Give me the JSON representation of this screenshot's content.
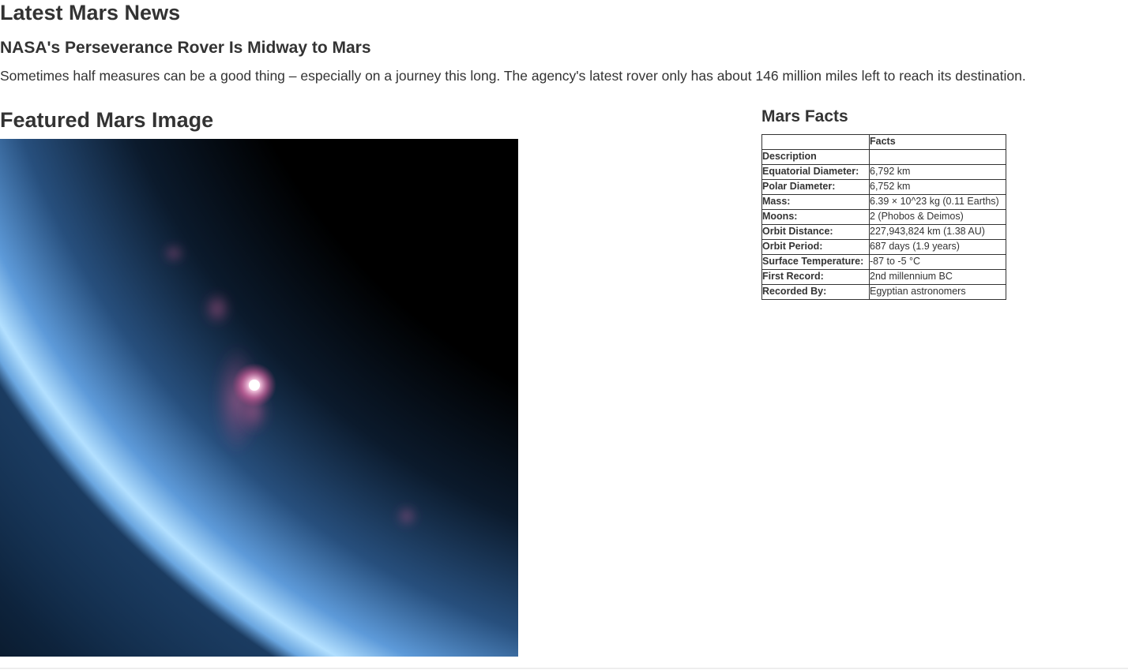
{
  "news": {
    "section_heading": "Latest Mars News",
    "title": "NASA's Perseverance Rover Is Midway to Mars",
    "teaser": "Sometimes half measures can be a good thing – especially on a journey this long. The agency's latest rover only has about 146 million miles left to reach its destination."
  },
  "featured": {
    "section_heading": "Featured Mars Image",
    "image_subject": "Mars limb with blue atmospheric haze and a bright pink star-like glow"
  },
  "facts": {
    "section_heading": "Mars Facts",
    "header_label": "",
    "header_value": "Facts",
    "index_label": "Description",
    "rows": [
      {
        "label": "Equatorial Diameter:",
        "value": "6,792 km"
      },
      {
        "label": "Polar Diameter:",
        "value": "6,752 km"
      },
      {
        "label": "Mass:",
        "value": "6.39 × 10^23 kg (0.11 Earths)"
      },
      {
        "label": "Moons:",
        "value": "2 (Phobos & Deimos)"
      },
      {
        "label": "Orbit Distance:",
        "value": "227,943,824 km (1.38 AU)"
      },
      {
        "label": "Orbit Period:",
        "value": "687 days (1.9 years)"
      },
      {
        "label": "Surface Temperature:",
        "value": "-87 to -5 °C"
      },
      {
        "label": "First Record:",
        "value": "2nd millennium BC"
      },
      {
        "label": "Recorded By:",
        "value": "Egyptian astronomers"
      }
    ]
  },
  "colors": {
    "text": "#333333",
    "background": "#ffffff",
    "table_border": "#333333"
  }
}
